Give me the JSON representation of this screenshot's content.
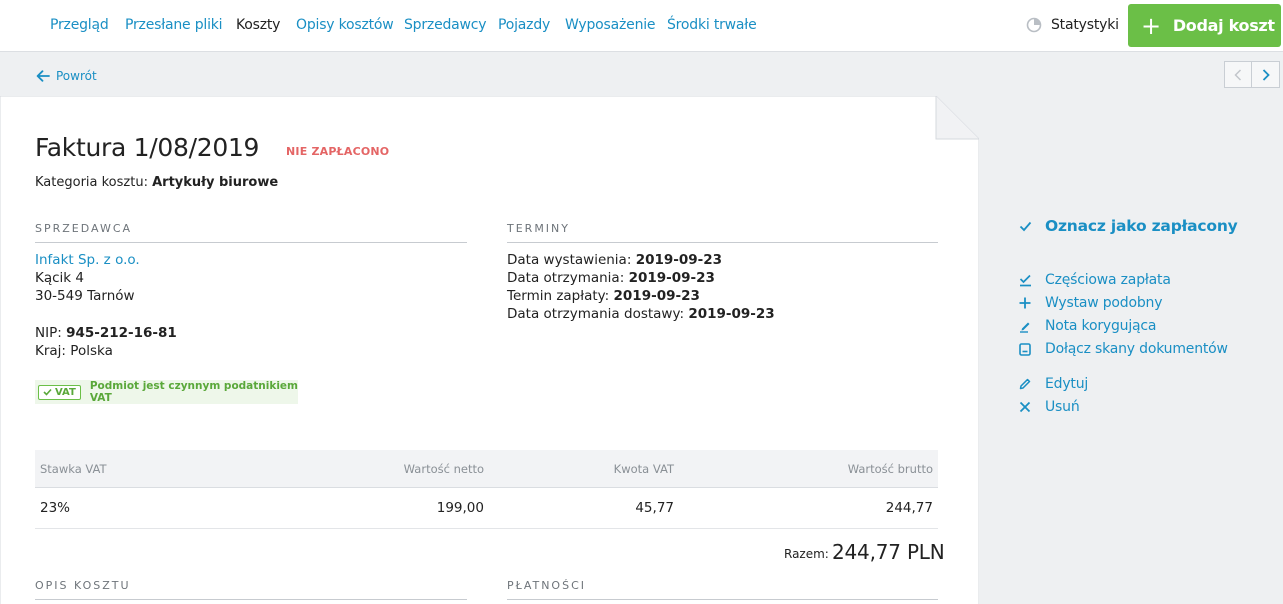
{
  "nav": {
    "items": [
      "Przegląd",
      "Przesłane pliki",
      "Koszty",
      "Opisy kosztów",
      "Sprzedawcy",
      "Pojazdy",
      "Wyposażenie",
      "Środki trwałe"
    ],
    "active": "Koszty",
    "stats_label": "Statystyki",
    "add_label": "Dodaj koszt"
  },
  "back_label": "Powrót",
  "invoice": {
    "title": "Faktura 1/08/2019",
    "status": "NIE ZAPŁACONO",
    "category_prefix": "Kategoria kosztu:",
    "category_value": "Artykuły biurowe"
  },
  "seller": {
    "heading": "SPRZEDAWCA",
    "name": "Infakt Sp. z o.o.",
    "street": "Kącik 4",
    "city": "30-549 Tarnów",
    "nip_label": "NIP:",
    "nip_value": "945-212-16-81",
    "country_label": "Kraj:",
    "country_value": "Polska",
    "vat_tag": "VAT",
    "vat_text": "Podmiot jest czynnym podatnikiem VAT"
  },
  "terms": {
    "heading": "TERMINY",
    "rows": [
      {
        "label": "Data wystawienia:",
        "value": "2019-09-23"
      },
      {
        "label": "Data otrzymania:",
        "value": "2019-09-23"
      },
      {
        "label": "Termin zapłaty:",
        "value": "2019-09-23"
      },
      {
        "label": "Data otrzymania dostawy:",
        "value": "2019-09-23"
      }
    ]
  },
  "table": {
    "headers": [
      "Stawka VAT",
      "Wartość netto",
      "Kwota VAT",
      "Wartość brutto"
    ],
    "rows": [
      [
        "23%",
        "199,00",
        "45,77",
        "244,77"
      ]
    ],
    "total_label": "Razem:",
    "total_value": "244,77 PLN"
  },
  "sections": {
    "description": "OPIS KOSZTU",
    "payments": "PŁATNOŚCI"
  },
  "actions": {
    "mark_paid": "Oznacz jako zapłacony",
    "partial": "Częściowa zapłata",
    "similar": "Wystaw podobny",
    "correction": "Nota korygująca",
    "attach": "Dołącz skany dokumentów",
    "edit": "Edytuj",
    "delete": "Usuń"
  },
  "colors": {
    "link": "#1a8fc4",
    "accent_green": "#6bbf47",
    "status_red": "#e46565"
  }
}
